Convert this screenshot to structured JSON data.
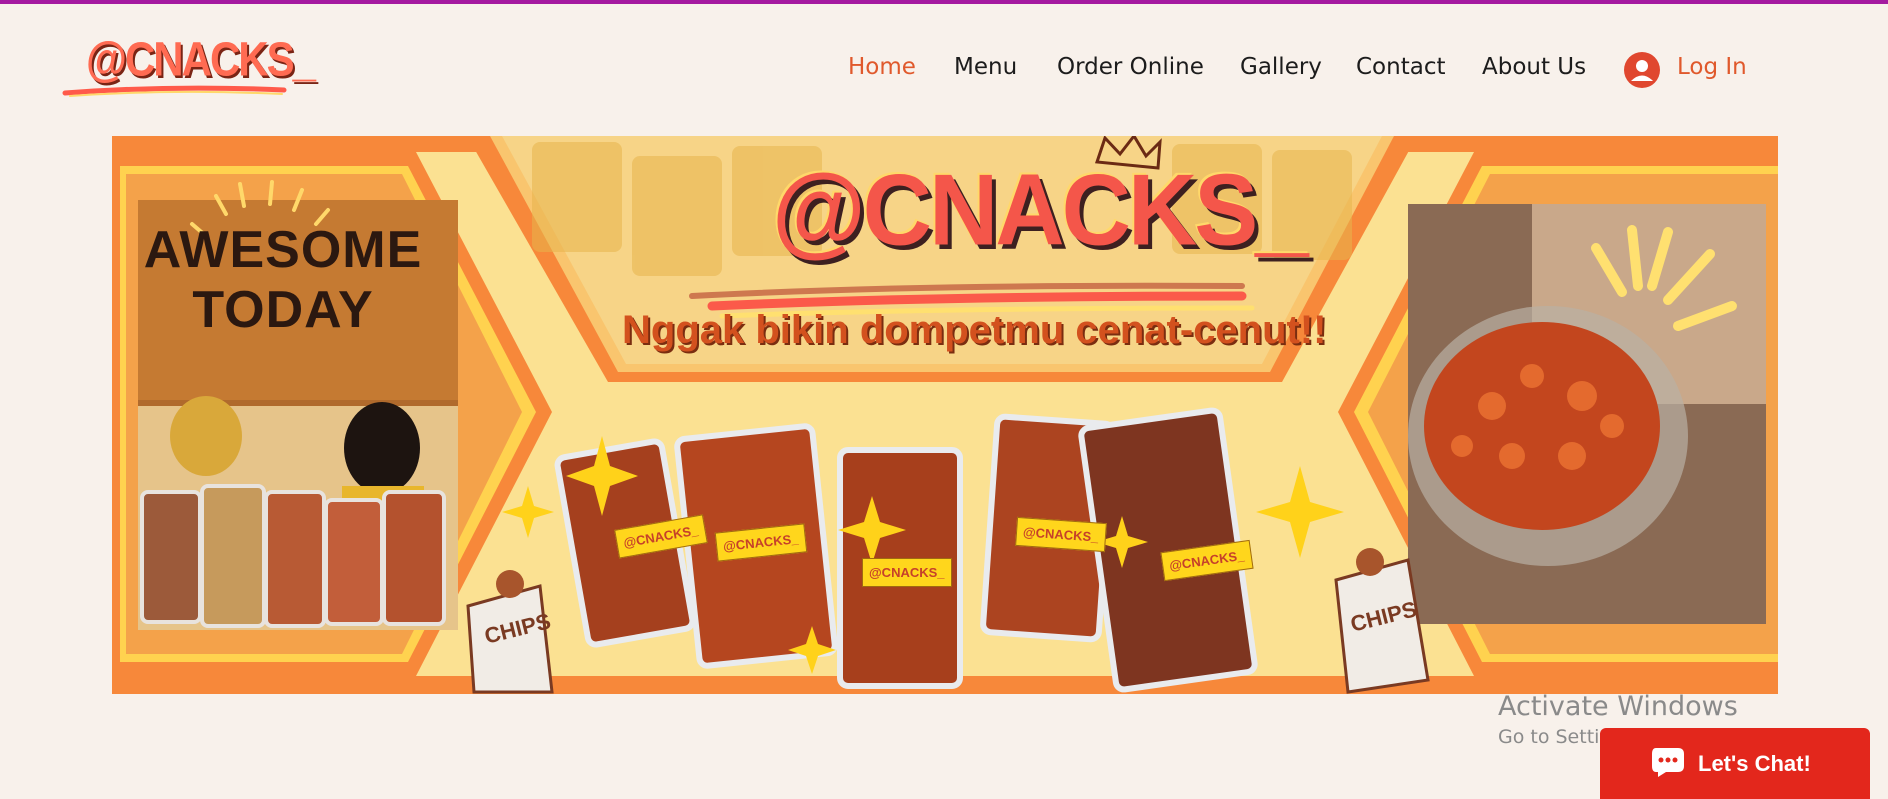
{
  "brand": {
    "logo_text": "@CNACKS_"
  },
  "nav": {
    "items": [
      {
        "label": "Home",
        "active": true
      },
      {
        "label": "Menu",
        "active": false
      },
      {
        "label": "Order Online",
        "active": false
      },
      {
        "label": "Gallery",
        "active": false
      },
      {
        "label": "Contact",
        "active": false
      },
      {
        "label": "About Us",
        "active": false
      }
    ],
    "login_label": "Log In"
  },
  "banner": {
    "brand": "@CNACKS_",
    "tagline": "Nggak bikin dompetmu cenat-cenut!!",
    "photo_sign_line1": "AWESOME",
    "photo_sign_line2": "TODAY",
    "bag_label": "@CNACKS_",
    "chips_label": "CHIPS"
  },
  "watermark": {
    "title": "Activate Windows",
    "subtitle": "Go to Settings to activate Windows."
  },
  "chat": {
    "label": "Let's Chat!"
  },
  "colors": {
    "accent": "#e0592c",
    "top_bar": "#a51aa0",
    "page_bg": "#f8f1eb",
    "banner_orange": "#f7883a",
    "banner_yellow": "#fbe192",
    "chat_red": "#e3271c"
  }
}
